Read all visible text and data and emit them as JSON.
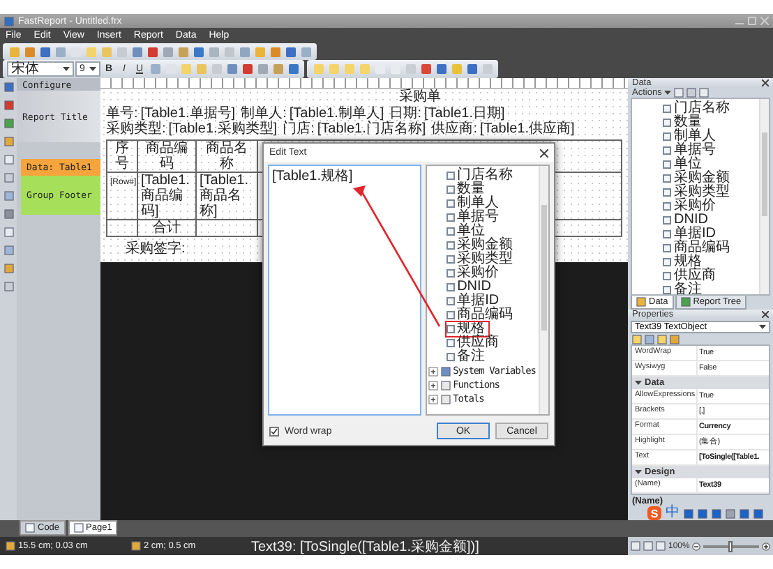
{
  "window": {
    "title": "FastReport - Untitled.frx"
  },
  "menu": [
    "File",
    "Edit",
    "View",
    "Insert",
    "Report",
    "Data",
    "Help"
  ],
  "format_bar": {
    "font": "宋体",
    "size": "9",
    "styles": [
      "B",
      "I",
      "U"
    ]
  },
  "bands": [
    {
      "label": "Configure",
      "kind": "header"
    },
    {
      "label": "Report Title",
      "kind": "title"
    },
    {
      "label": "Data: Table1",
      "kind": "data"
    },
    {
      "label": "Group Footer",
      "kind": "footer"
    }
  ],
  "report": {
    "title": "采购单",
    "field_rows": [
      [
        {
          "label": "单号:",
          "value": "[Table1.单据号]"
        },
        {
          "label": "制单人:",
          "value": "[Table1.制单人]"
        },
        {
          "label": "日期:",
          "value": "[Table1.日期]"
        }
      ],
      [
        {
          "label": "采购类型:",
          "value": "[Table1.采购类型]"
        },
        {
          "label": "门店:",
          "value": "[Table1.门店名称]"
        },
        {
          "label": "供应商:",
          "value": "[Table1.供应商]"
        }
      ]
    ],
    "columns": [
      {
        "heading": "序号",
        "cell": "[Row#]"
      },
      {
        "heading": "商品编码",
        "cell": "[Table1.商品编码]"
      },
      {
        "heading": "商品名称",
        "cell": "[Table1.商品名称]"
      }
    ],
    "total": "合计",
    "signature": "采购签字:"
  },
  "dialog": {
    "title": "Edit Text",
    "text": "[Table1.规格]",
    "tree": [
      {
        "label": "门店名称",
        "kind": "field",
        "selected": false
      },
      {
        "label": "数量",
        "kind": "field",
        "selected": false
      },
      {
        "label": "制单人",
        "kind": "field",
        "selected": false
      },
      {
        "label": "单据号",
        "kind": "field",
        "selected": false
      },
      {
        "label": "单位",
        "kind": "field",
        "selected": false
      },
      {
        "label": "采购金额",
        "kind": "field",
        "selected": false
      },
      {
        "label": "采购类型",
        "kind": "field",
        "selected": false
      },
      {
        "label": "采购价",
        "kind": "field",
        "selected": false
      },
      {
        "label": "DNID",
        "kind": "field",
        "selected": false
      },
      {
        "label": "单据ID",
        "kind": "field",
        "selected": false
      },
      {
        "label": "商品编码",
        "kind": "field",
        "selected": false
      },
      {
        "label": "规格",
        "kind": "field",
        "selected": true
      },
      {
        "label": "供应商",
        "kind": "field",
        "selected": false
      },
      {
        "label": "备注",
        "kind": "field",
        "selected": false
      },
      {
        "label": "System Variables",
        "kind": "group",
        "selected": false
      },
      {
        "label": "Functions",
        "kind": "functions",
        "selected": false
      },
      {
        "label": "Totals",
        "kind": "totals",
        "selected": false
      }
    ],
    "word_wrap": {
      "label": "Word wrap",
      "checked": true
    },
    "buttons": [
      "OK",
      "Cancel"
    ]
  },
  "data_panel": {
    "title": "Data",
    "actions": "Actions",
    "fields": [
      "门店名称",
      "数量",
      "制单人",
      "单据号",
      "单位",
      "采购金额",
      "采购类型",
      "采购价",
      "DNID",
      "单据ID",
      "商品编码",
      "规格",
      "供应商",
      "备注"
    ],
    "tabs": [
      {
        "label": "Data",
        "selected": true
      },
      {
        "label": "Report Tree",
        "selected": false
      }
    ]
  },
  "properties": {
    "title": "Properties",
    "object": "Text39 TextObject",
    "rows": [
      {
        "kind": "property",
        "name": "WordWrap",
        "value": "True",
        "modified": false
      },
      {
        "kind": "property",
        "name": "Wysiwyg",
        "value": "False",
        "modified": false
      },
      {
        "kind": "section",
        "name": "Data"
      },
      {
        "kind": "property",
        "name": "AllowExpressions",
        "value": "True",
        "modified": false
      },
      {
        "kind": "property",
        "name": "Brackets",
        "value": "[,]",
        "modified": false
      },
      {
        "kind": "property",
        "name": "Format",
        "value": "Currency",
        "modified": true
      },
      {
        "kind": "property",
        "name": "Highlight",
        "value": "(集合)",
        "modified": false
      },
      {
        "kind": "property",
        "name": "Text",
        "value": "[ToSingle([Table1.",
        "modified": true
      },
      {
        "kind": "section",
        "name": "Design"
      },
      {
        "kind": "property",
        "name": "(Name)",
        "value": "Text39",
        "modified": true
      }
    ],
    "description": "(Name)"
  },
  "ime": {
    "logo": "S",
    "mode": "中"
  },
  "page_tabs": [
    {
      "label": "Code",
      "selected": false
    },
    {
      "label": "Page1",
      "selected": true
    }
  ],
  "status_bar": {
    "position": "15.5 cm; 0.03 cm",
    "size": "2 cm; 0.5 cm",
    "object": "Text39:  [ToSingle([Table1.采购金额])]",
    "zoom": "100%",
    "zoom_slider": {
      "level": 0.5
    }
  }
}
